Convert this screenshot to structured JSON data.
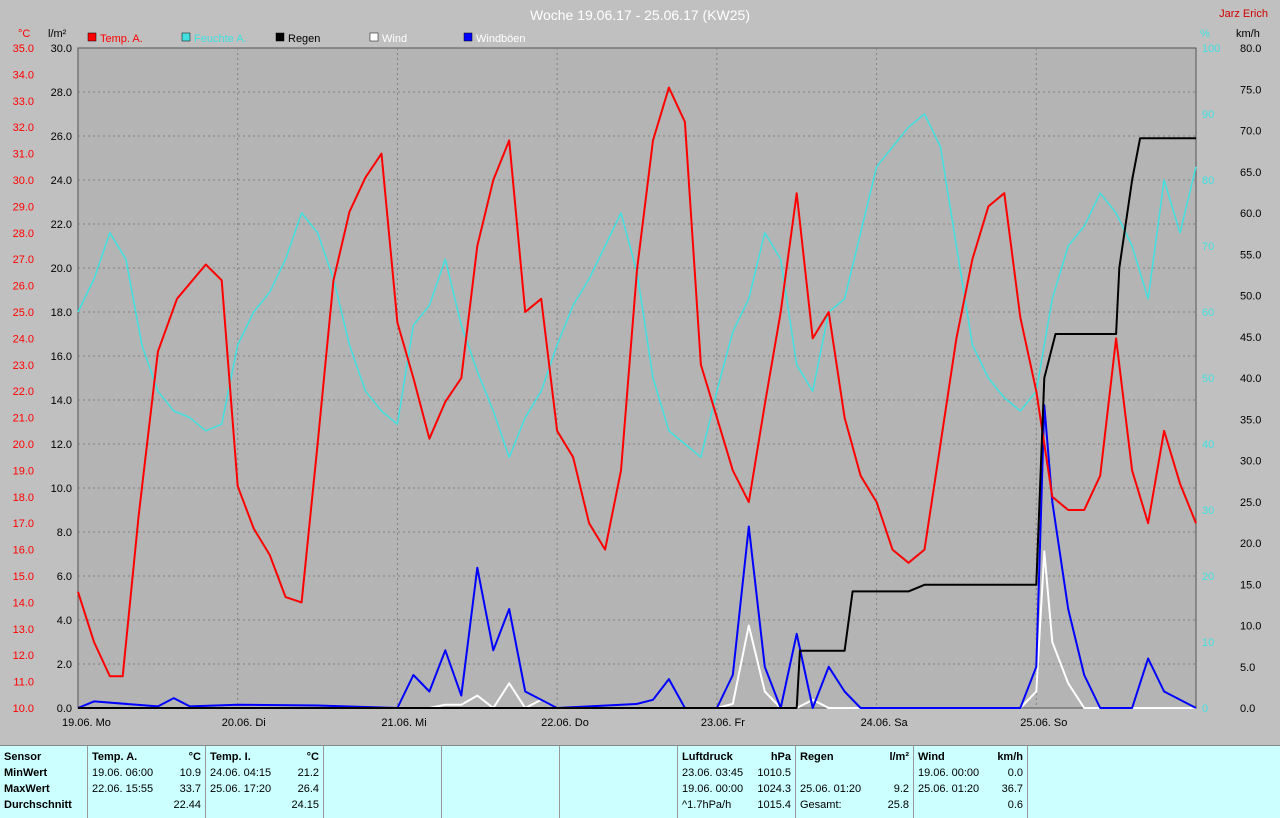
{
  "colors": {
    "temp": "#ff0000",
    "humidity": "#40e0e0",
    "rain": "#000000",
    "wind": "#ffffff",
    "gust": "#0000ff",
    "grid": "#808080"
  },
  "chart_data": {
    "type": "line",
    "title": "Woche 19.06.17 - 25.06.17 (KW25)",
    "author": "Jarz Erich",
    "x_range": [
      0,
      7
    ],
    "x_ticks": [
      {
        "v": 0,
        "label": "19.06.  Mo"
      },
      {
        "v": 1,
        "label": "20.06.  Di"
      },
      {
        "v": 2,
        "label": "21.06.  Mi"
      },
      {
        "v": 3,
        "label": "22.06.  Do"
      },
      {
        "v": 4,
        "label": "23.06.  Fr"
      },
      {
        "v": 5,
        "label": "24.06.  Sa"
      },
      {
        "v": 6,
        "label": "25.06.  So"
      }
    ],
    "axes": {
      "temp": {
        "unit": "°C",
        "min": 10,
        "max": 35,
        "step": 1
      },
      "rain": {
        "unit": "l/m²",
        "min": 0,
        "max": 30,
        "step": 2
      },
      "humidity": {
        "unit": "%",
        "min": 0,
        "max": 100,
        "step": 10
      },
      "wind": {
        "unit": "km/h",
        "min": 0,
        "max": 80,
        "step": 5
      }
    },
    "legend": [
      {
        "key": "temp",
        "label": "Temp. A."
      },
      {
        "key": "humidity",
        "label": "Feuchte A."
      },
      {
        "key": "rain",
        "label": "Regen"
      },
      {
        "key": "wind",
        "label": "Wind"
      },
      {
        "key": "gust",
        "label": "Windböen"
      }
    ],
    "series": {
      "temp": [
        [
          0,
          14.4
        ],
        [
          0.1,
          12.5
        ],
        [
          0.2,
          11.2
        ],
        [
          0.28,
          11.2
        ],
        [
          0.38,
          17.3
        ],
        [
          0.5,
          23.5
        ],
        [
          0.62,
          25.5
        ],
        [
          0.8,
          26.8
        ],
        [
          0.9,
          26.2
        ],
        [
          1.0,
          18.4
        ],
        [
          1.1,
          16.8
        ],
        [
          1.2,
          15.8
        ],
        [
          1.3,
          14.2
        ],
        [
          1.4,
          14.0
        ],
        [
          1.5,
          20.0
        ],
        [
          1.6,
          26.2
        ],
        [
          1.7,
          28.8
        ],
        [
          1.8,
          30.1
        ],
        [
          1.9,
          31.0
        ],
        [
          2.0,
          24.6
        ],
        [
          2.1,
          22.5
        ],
        [
          2.2,
          20.2
        ],
        [
          2.3,
          21.6
        ],
        [
          2.4,
          22.5
        ],
        [
          2.5,
          27.5
        ],
        [
          2.6,
          30.0
        ],
        [
          2.7,
          31.5
        ],
        [
          2.8,
          25.0
        ],
        [
          2.9,
          25.5
        ],
        [
          3.0,
          20.5
        ],
        [
          3.1,
          19.5
        ],
        [
          3.2,
          17.0
        ],
        [
          3.3,
          16.0
        ],
        [
          3.4,
          19.0
        ],
        [
          3.5,
          26.6
        ],
        [
          3.6,
          31.5
        ],
        [
          3.7,
          33.5
        ],
        [
          3.8,
          32.2
        ],
        [
          3.9,
          23.0
        ],
        [
          4.0,
          21.0
        ],
        [
          4.1,
          19.0
        ],
        [
          4.2,
          17.8
        ],
        [
          4.3,
          21.5
        ],
        [
          4.4,
          25.0
        ],
        [
          4.5,
          29.5
        ],
        [
          4.6,
          24.0
        ],
        [
          4.7,
          25.0
        ],
        [
          4.8,
          21.0
        ],
        [
          4.9,
          18.8
        ],
        [
          5.0,
          17.8
        ],
        [
          5.1,
          16.0
        ],
        [
          5.2,
          15.5
        ],
        [
          5.3,
          16.0
        ],
        [
          5.4,
          20.0
        ],
        [
          5.5,
          24.0
        ],
        [
          5.6,
          27.0
        ],
        [
          5.7,
          29.0
        ],
        [
          5.8,
          29.5
        ],
        [
          5.9,
          24.8
        ],
        [
          6.0,
          22.0
        ],
        [
          6.1,
          18.0
        ],
        [
          6.2,
          17.5
        ],
        [
          6.3,
          17.5
        ],
        [
          6.4,
          18.8
        ],
        [
          6.5,
          24.0
        ],
        [
          6.6,
          19.0
        ],
        [
          6.7,
          17.0
        ],
        [
          6.8,
          20.5
        ],
        [
          6.9,
          18.5
        ],
        [
          7.0,
          17.0
        ]
      ],
      "humidity": [
        [
          0,
          60
        ],
        [
          0.1,
          65
        ],
        [
          0.2,
          72
        ],
        [
          0.3,
          68
        ],
        [
          0.4,
          55
        ],
        [
          0.5,
          48
        ],
        [
          0.6,
          45
        ],
        [
          0.7,
          44
        ],
        [
          0.8,
          42
        ],
        [
          0.9,
          43
        ],
        [
          1.0,
          55
        ],
        [
          1.1,
          60
        ],
        [
          1.2,
          63
        ],
        [
          1.3,
          68
        ],
        [
          1.4,
          75
        ],
        [
          1.5,
          72
        ],
        [
          1.6,
          65
        ],
        [
          1.7,
          55
        ],
        [
          1.8,
          48
        ],
        [
          1.9,
          45
        ],
        [
          2.0,
          43
        ],
        [
          2.1,
          58
        ],
        [
          2.2,
          61
        ],
        [
          2.3,
          68
        ],
        [
          2.4,
          58
        ],
        [
          2.5,
          51
        ],
        [
          2.6,
          45
        ],
        [
          2.7,
          38
        ],
        [
          2.8,
          44
        ],
        [
          2.9,
          48
        ],
        [
          3.0,
          55
        ],
        [
          3.1,
          61
        ],
        [
          3.2,
          65
        ],
        [
          3.3,
          70
        ],
        [
          3.4,
          75
        ],
        [
          3.5,
          66
        ],
        [
          3.6,
          50
        ],
        [
          3.7,
          42
        ],
        [
          3.8,
          40
        ],
        [
          3.9,
          38
        ],
        [
          4.0,
          48
        ],
        [
          4.1,
          57
        ],
        [
          4.2,
          62
        ],
        [
          4.3,
          72
        ],
        [
          4.4,
          68
        ],
        [
          4.5,
          52
        ],
        [
          4.6,
          48
        ],
        [
          4.7,
          60
        ],
        [
          4.8,
          62
        ],
        [
          4.9,
          72
        ],
        [
          5.0,
          82
        ],
        [
          5.1,
          85
        ],
        [
          5.2,
          88
        ],
        [
          5.3,
          90
        ],
        [
          5.4,
          85
        ],
        [
          5.5,
          70
        ],
        [
          5.6,
          55
        ],
        [
          5.7,
          50
        ],
        [
          5.8,
          47
        ],
        [
          5.9,
          45
        ],
        [
          6.0,
          48
        ],
        [
          6.1,
          62
        ],
        [
          6.2,
          70
        ],
        [
          6.3,
          73
        ],
        [
          6.4,
          78
        ],
        [
          6.5,
          75
        ],
        [
          6.6,
          70
        ],
        [
          6.7,
          62
        ],
        [
          6.8,
          80
        ],
        [
          6.9,
          72
        ],
        [
          7.0,
          82
        ]
      ],
      "rain": [
        [
          0,
          0
        ],
        [
          4.5,
          0
        ],
        [
          4.52,
          2.6
        ],
        [
          4.8,
          2.6
        ],
        [
          4.85,
          5.3
        ],
        [
          5.0,
          5.3
        ],
        [
          5.2,
          5.3
        ],
        [
          5.3,
          5.6
        ],
        [
          5.6,
          5.6
        ],
        [
          5.9,
          5.6
        ],
        [
          6.0,
          5.6
        ],
        [
          6.05,
          15.0
        ],
        [
          6.12,
          17.0
        ],
        [
          6.2,
          17.0
        ],
        [
          6.5,
          17.0
        ],
        [
          6.52,
          20.0
        ],
        [
          6.6,
          24.0
        ],
        [
          6.65,
          25.9
        ],
        [
          6.8,
          25.9
        ],
        [
          7.0,
          25.9
        ]
      ],
      "wind": [
        [
          0,
          0
        ],
        [
          2.2,
          0
        ],
        [
          2.3,
          0.4
        ],
        [
          2.4,
          0.4
        ],
        [
          2.5,
          1.5
        ],
        [
          2.6,
          0
        ],
        [
          2.7,
          3.0
        ],
        [
          2.8,
          0
        ],
        [
          2.9,
          1.0
        ],
        [
          3.0,
          0
        ],
        [
          4.0,
          0
        ],
        [
          4.1,
          0.5
        ],
        [
          4.2,
          10.0
        ],
        [
          4.3,
          2.0
        ],
        [
          4.4,
          0
        ],
        [
          4.5,
          0
        ],
        [
          4.6,
          1.0
        ],
        [
          4.7,
          0
        ],
        [
          5.9,
          0
        ],
        [
          6.0,
          2.0
        ],
        [
          6.05,
          19.0
        ],
        [
          6.1,
          8.0
        ],
        [
          6.2,
          3.0
        ],
        [
          6.3,
          0
        ],
        [
          6.6,
          0
        ],
        [
          7.0,
          0
        ]
      ],
      "gust": [
        [
          0,
          0
        ],
        [
          0.1,
          0.8
        ],
        [
          0.5,
          0.2
        ],
        [
          0.6,
          1.2
        ],
        [
          0.7,
          0.2
        ],
        [
          1.0,
          0.4
        ],
        [
          1.5,
          0.3
        ],
        [
          2.0,
          0
        ],
        [
          2.1,
          4.0
        ],
        [
          2.2,
          2.0
        ],
        [
          2.3,
          7.0
        ],
        [
          2.4,
          1.5
        ],
        [
          2.5,
          17.0
        ],
        [
          2.6,
          7.0
        ],
        [
          2.7,
          12.0
        ],
        [
          2.8,
          2.0
        ],
        [
          3.0,
          0
        ],
        [
          3.5,
          0.5
        ],
        [
          3.6,
          1.0
        ],
        [
          3.7,
          3.5
        ],
        [
          3.8,
          0
        ],
        [
          4.0,
          0
        ],
        [
          4.1,
          4.0
        ],
        [
          4.2,
          22.0
        ],
        [
          4.3,
          5.0
        ],
        [
          4.4,
          0
        ],
        [
          4.5,
          9.0
        ],
        [
          4.6,
          0
        ],
        [
          4.7,
          5.0
        ],
        [
          4.8,
          2.0
        ],
        [
          4.9,
          0
        ],
        [
          5.9,
          0
        ],
        [
          6.0,
          5.0
        ],
        [
          6.05,
          36.7
        ],
        [
          6.1,
          25.0
        ],
        [
          6.2,
          12.0
        ],
        [
          6.3,
          4.0
        ],
        [
          6.4,
          0
        ],
        [
          6.6,
          0
        ],
        [
          6.7,
          6.0
        ],
        [
          6.8,
          2.0
        ],
        [
          7.0,
          0
        ]
      ]
    }
  },
  "stats": {
    "sensor": {
      "header": "Sensor",
      "rows": [
        "MinWert",
        "MaxWert",
        "Durchschnitt"
      ]
    },
    "temp_a": {
      "header": "Temp. A.",
      "unit": "°C",
      "rows": [
        {
          "time": "19.06.  06:00",
          "value": "10.9"
        },
        {
          "time": "22.06.  15:55",
          "value": "33.7"
        },
        {
          "time": "",
          "value": "22.44"
        }
      ]
    },
    "temp_i": {
      "header": "Temp. I.",
      "unit": "°C",
      "rows": [
        {
          "time": "24.06.  04:15",
          "value": "21.2"
        },
        {
          "time": "25.06.  17:20",
          "value": "26.4"
        },
        {
          "time": "",
          "value": "24.15"
        }
      ]
    },
    "pressure": {
      "header": "Luftdruck",
      "unit": "hPa",
      "rows": [
        {
          "time": "23.06.  03:45",
          "value": "1010.5"
        },
        {
          "time": "19.06.  00:00",
          "value": "1024.3"
        },
        {
          "time": "^1.7hPa/h",
          "value": "1015.4"
        }
      ]
    },
    "rain": {
      "header": "Regen",
      "unit": "l/m²",
      "rows": [
        {
          "time": "",
          "value": ""
        },
        {
          "time": "25.06.  01:20",
          "value": "9.2"
        },
        {
          "time": "Gesamt:",
          "value": "25.8"
        }
      ]
    },
    "wind": {
      "header": "Wind",
      "unit": "km/h",
      "rows": [
        {
          "time": "19.06.  00:00",
          "value": "0.0"
        },
        {
          "time": "25.06.  01:20",
          "value": "36.7"
        },
        {
          "time": "",
          "value": "0.6"
        }
      ]
    }
  }
}
